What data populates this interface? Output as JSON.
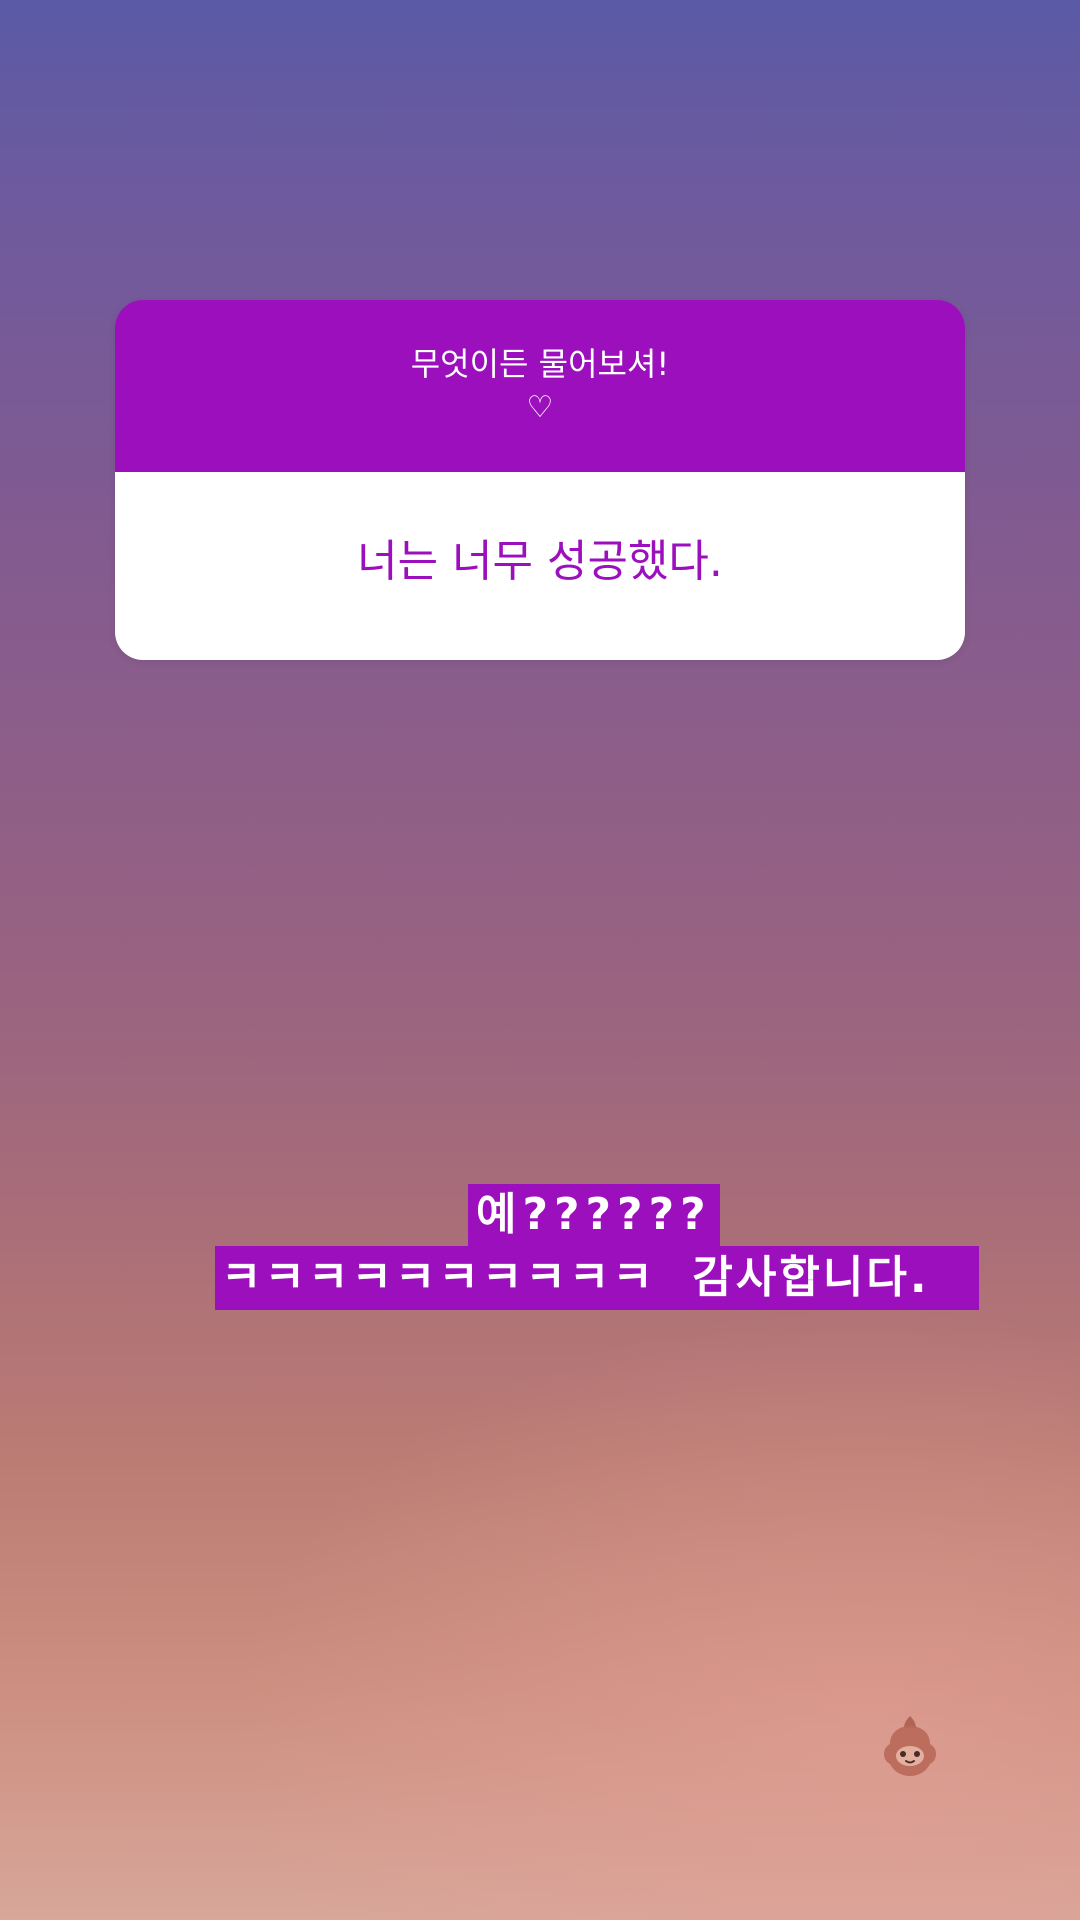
{
  "question_sticker": {
    "prompt": "무엇이든 물어보셔!",
    "heart": "♡",
    "answer": "너는 너무 성공했다."
  },
  "caption": {
    "line1": "예??????",
    "line2": "ㅋㅋㅋㅋㅋㅋㅋㅋㅋㅋ  감사합니다."
  },
  "colors": {
    "accent": "#9c0fbc",
    "card_body": "#ffffff"
  },
  "stickers": {
    "corner_sticker": "character-face-icon"
  }
}
